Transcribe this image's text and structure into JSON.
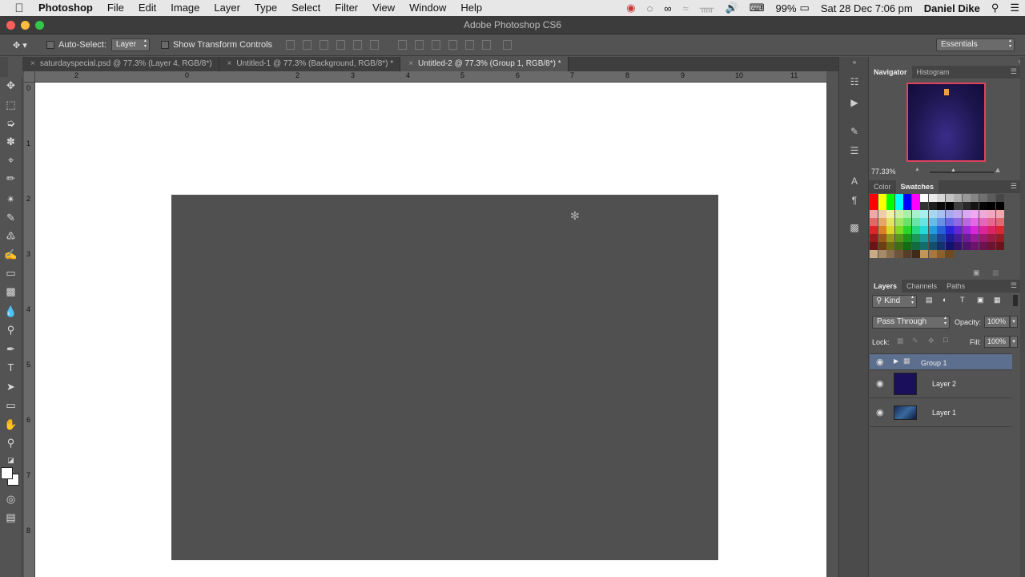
{
  "menubar": {
    "app": "Photoshop",
    "items": [
      "File",
      "Edit",
      "Image",
      "Layer",
      "Type",
      "Select",
      "Filter",
      "View",
      "Window",
      "Help"
    ],
    "battery": "99%",
    "datetime": "Sat 28 Dec  7:06 pm",
    "user": "Daniel Dike"
  },
  "window": {
    "title": "Adobe Photoshop CS6"
  },
  "options": {
    "auto_select_label": "Auto-Select:",
    "auto_select_value": "Layer",
    "show_transform_label": "Show Transform Controls",
    "workspace": "Essentials"
  },
  "tabs": [
    {
      "label": "saturdayspecial.psd @ 77.3% (Layer 4, RGB/8*)"
    },
    {
      "label": "Untitled-1 @ 77.3% (Background, RGB/8*) *"
    },
    {
      "label": "Untitled-2 @ 77.3% (Group 1, RGB/8*) *"
    }
  ],
  "ruler": {
    "h_labels": [
      "2",
      "0",
      "2",
      "3",
      "4",
      "5",
      "6",
      "7",
      "8",
      "9",
      "10",
      "11"
    ],
    "v_labels": [
      "0",
      "1",
      "2",
      "3",
      "4",
      "5",
      "6",
      "7",
      "8"
    ]
  },
  "navigator": {
    "tabs": [
      "Navigator",
      "Histogram"
    ],
    "zoom": "77.33%"
  },
  "color_panel": {
    "tabs": [
      "Color",
      "Swatches"
    ]
  },
  "layers_panel": {
    "tabs": [
      "Layers",
      "Channels",
      "Paths"
    ],
    "filter_label": "Kind",
    "blend_mode": "Pass Through",
    "opacity_label": "Opacity:",
    "opacity_value": "100%",
    "lock_label": "Lock:",
    "fill_label": "Fill:",
    "fill_value": "100%",
    "layers": [
      {
        "name": "Group 1",
        "selected": true
      },
      {
        "name": "Layer 2",
        "selected": false
      },
      {
        "name": "Layer 1",
        "selected": false
      }
    ]
  },
  "colors": {
    "layer2_thumb": "#1a0f5a",
    "selection": "#5d6f8f",
    "doc_fill": "#505050"
  }
}
